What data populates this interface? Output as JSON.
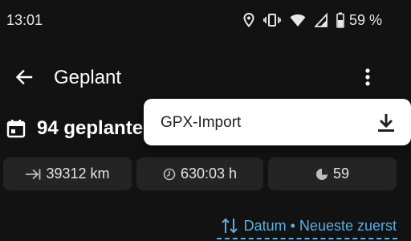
{
  "status_bar": {
    "time": "13:01",
    "battery_text": "59 %",
    "icons": [
      "location-icon",
      "vibrate-icon",
      "wifi-icon",
      "cell-signal-icon",
      "battery-icon"
    ]
  },
  "app_bar": {
    "title": "Geplant",
    "back_icon": "arrow-left-icon",
    "more_icon": "more-vert-icon"
  },
  "section": {
    "icon": "calendar-icon",
    "title": "94 geplante"
  },
  "stats": {
    "distance": {
      "icon": "route-arrow-icon",
      "value": "39312 km"
    },
    "duration": {
      "icon": "clock-icon",
      "value": "630:03 h"
    },
    "count": {
      "icon": "pie-icon",
      "value": "59"
    }
  },
  "sort": {
    "icon": "sort-arrows-icon",
    "label": "Datum • Neueste zuerst"
  },
  "menu": {
    "items": [
      {
        "label": "GPX-Import",
        "icon": "download-icon"
      }
    ]
  },
  "colors": {
    "background": "#121212",
    "chip": "#242424",
    "accent": "#5aaee0",
    "menu_bg": "#ffffff"
  }
}
